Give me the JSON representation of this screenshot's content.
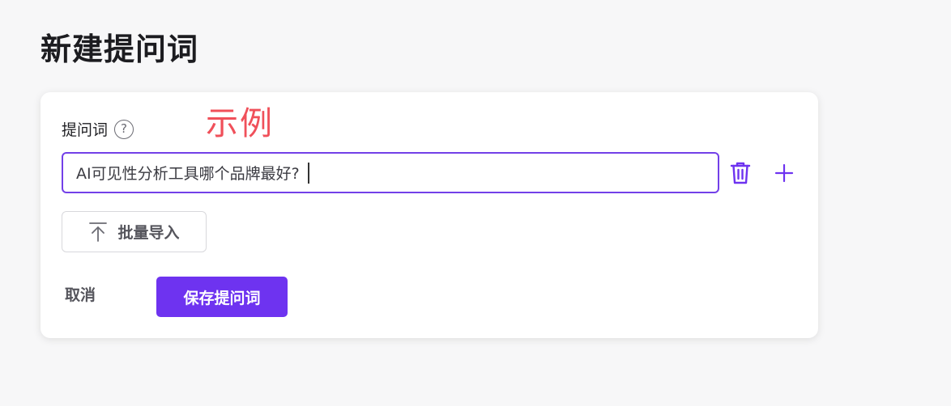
{
  "page": {
    "title": "新建提问词"
  },
  "annotation": {
    "text": "示例"
  },
  "form": {
    "label": "提问词",
    "help_icon": "question-circle-icon",
    "input_value": "AI可见性分析工具哪个品牌最好?",
    "delete_icon": "trash-icon",
    "add_icon": "plus-icon"
  },
  "actions": {
    "import_label": "批量导入",
    "import_icon": "upload-icon",
    "cancel_label": "取消",
    "save_label": "保存提问词"
  },
  "colors": {
    "accent": "#6e33f0",
    "input_border": "#7340e8",
    "annotation": "#f0505a",
    "background": "#f7f7f8"
  }
}
